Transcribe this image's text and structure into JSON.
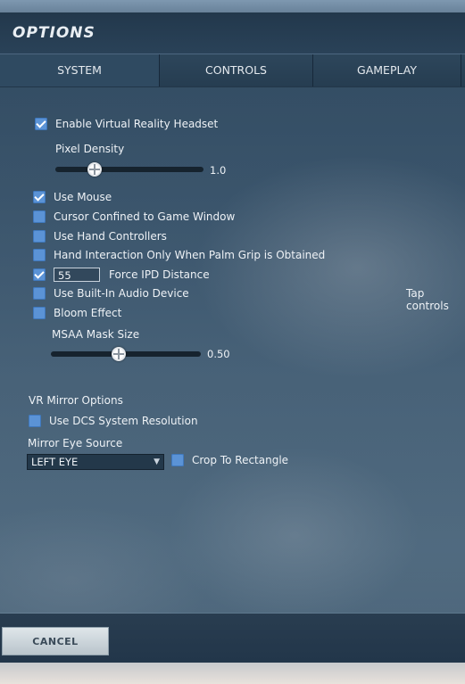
{
  "window": {
    "title": "OPTIONS"
  },
  "tabs": [
    {
      "label": "SYSTEM",
      "active": true
    },
    {
      "label": "CONTROLS",
      "active": false
    },
    {
      "label": "GAMEPLAY",
      "active": false
    }
  ],
  "vr": {
    "enable_headset": {
      "label": "Enable Virtual Reality Headset",
      "checked": true
    },
    "pixel_density": {
      "label": "Pixel Density",
      "value": "1.0",
      "fraction": 0.25
    },
    "use_mouse": {
      "label": "Use Mouse",
      "checked": true
    },
    "cursor_confined": {
      "label": "Cursor Confined to Game Window",
      "checked": false
    },
    "hand_controllers": {
      "label": "Use Hand Controllers",
      "checked": false
    },
    "hand_palm_grip": {
      "label": "Hand Interaction Only When Palm Grip is Obtained",
      "checked": false
    },
    "force_ipd": {
      "label": "Force IPD Distance",
      "checked": true,
      "value": "55"
    },
    "builtin_audio": {
      "label": "Use Built-In Audio Device",
      "checked": false
    },
    "tap_controls": "Tap controls",
    "bloom": {
      "label": "Bloom Effect",
      "checked": false
    },
    "msaa": {
      "label": "MSAA Mask Size",
      "value": "0.50",
      "fraction": 0.45
    }
  },
  "mirror": {
    "heading": "VR Mirror Options",
    "dcs_resolution": {
      "label": "Use DCS System Resolution",
      "checked": false
    },
    "eye_source_label": "Mirror Eye Source",
    "eye_source_value": "LEFT EYE",
    "crop": {
      "label": "Crop To Rectangle",
      "checked": false
    }
  },
  "footer": {
    "cancel_label": "CANCEL"
  }
}
